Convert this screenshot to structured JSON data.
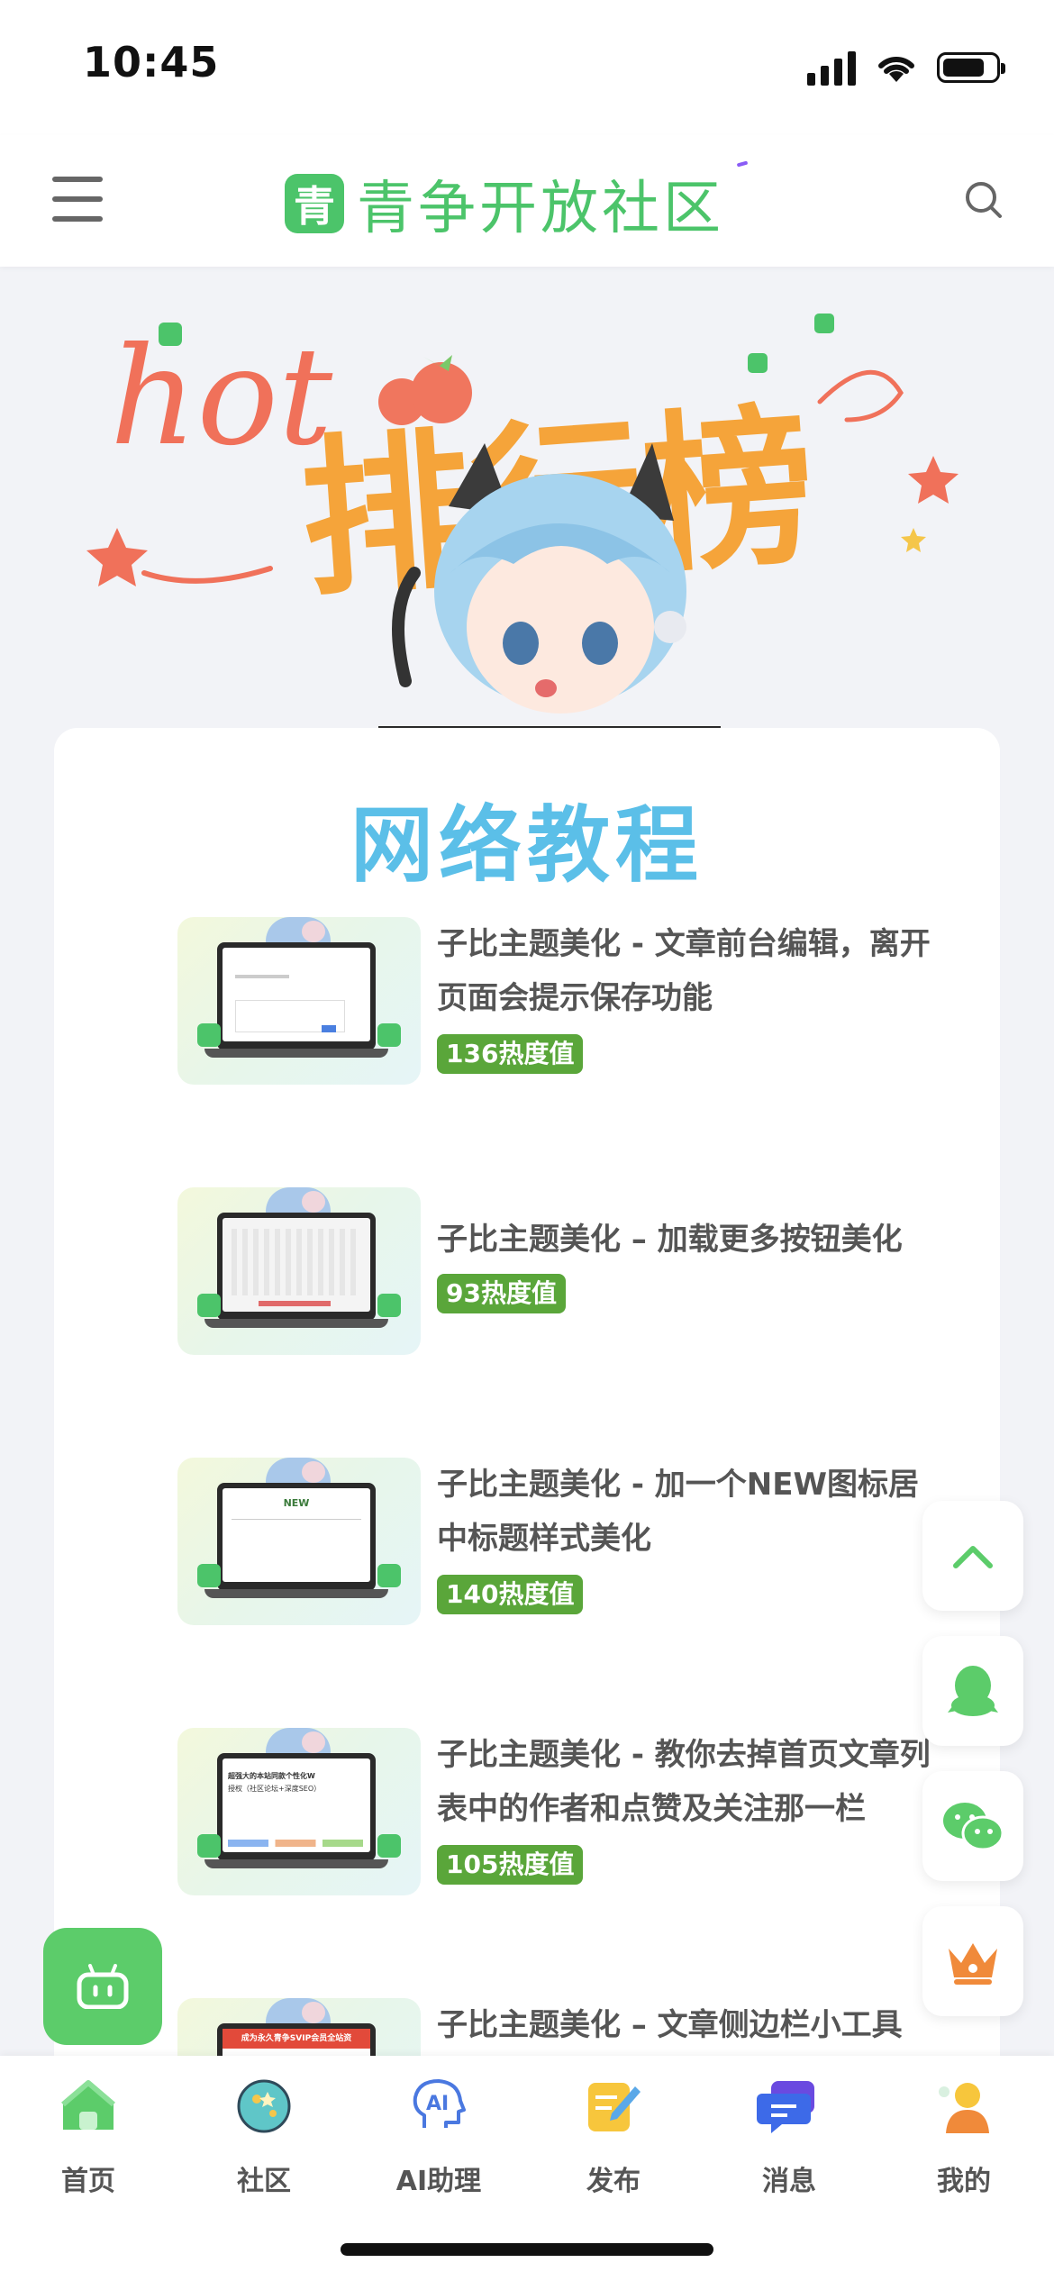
{
  "status_bar": {
    "time": "10:45"
  },
  "header": {
    "logo_mark": "青",
    "logo_text": "青争开放社区"
  },
  "hero": {
    "hot_text": "hot",
    "title": "排行榜"
  },
  "section": {
    "title": "网络教程"
  },
  "posts": [
    {
      "title": "子比主题美化 - 文章前台编辑，离开页面会提示保存功能",
      "heat": "136热度值"
    },
    {
      "title": "子比主题美化 – 加载更多按钮美化",
      "heat": "93热度值"
    },
    {
      "title": "子比主题美化 - 加一个NEW图标居中标题样式美化",
      "heat": "140热度值"
    },
    {
      "title": "子比主题美化 - 教你去掉首页文章列表中的作者和点赞及关注那一栏",
      "heat": "105热度值"
    },
    {
      "title": "子比主题美化 – 文章侧边栏小工具",
      "heat": ""
    }
  ],
  "thumb_text": {
    "post3_new": "NEW",
    "post4_line1": "超强大的本站同款个性化W",
    "post4_line2": "授权（社区论坛+深度SEO）",
    "post5_banner": "成为永久青争SVIP会员全站资"
  },
  "floating": {
    "items": [
      {
        "icon": "chevron-up-icon"
      },
      {
        "icon": "qq-icon"
      },
      {
        "icon": "wechat-icon"
      },
      {
        "icon": "crown-icon"
      }
    ]
  },
  "tabbar": {
    "items": [
      {
        "label": "首页",
        "icon": "home-icon"
      },
      {
        "label": "社区",
        "icon": "planet-icon"
      },
      {
        "label": "AI助理",
        "icon": "ai-assistant-icon"
      },
      {
        "label": "发布",
        "icon": "publish-icon"
      },
      {
        "label": "消息",
        "icon": "message-icon"
      },
      {
        "label": "我的",
        "icon": "profile-icon"
      }
    ]
  },
  "colors": {
    "brand_green": "#4cc46a",
    "badge_green": "#5aa63a",
    "section_blue": "#5bbfe8",
    "hot_coral": "#f0715a",
    "title_orange": "#f5a43a"
  }
}
